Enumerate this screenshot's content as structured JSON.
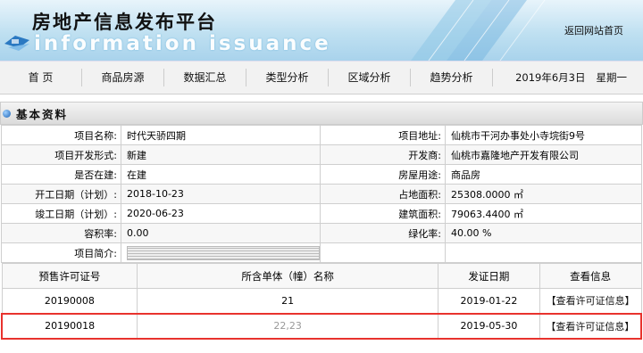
{
  "header": {
    "title": "房地产信息发布平台",
    "subtitle": "information issuance",
    "home_link": "返回网站首页"
  },
  "nav": {
    "items": [
      "首 页",
      "商品房源",
      "数据汇总",
      "类型分析",
      "区域分析",
      "趋势分析"
    ],
    "date": "2019年6月3日",
    "weekday": "星期一"
  },
  "section": {
    "title": "基本资料"
  },
  "info": {
    "rows": [
      {
        "l1": "项目名称:",
        "v1": "时代天骄四期",
        "l2": "项目地址:",
        "v2": "仙桃市干河办事处小寺垸街9号"
      },
      {
        "l1": "项目开发形式:",
        "v1": "新建",
        "l2": "开发商:",
        "v2": "仙桃市嘉隆地产开发有限公司"
      },
      {
        "l1": "是否在建:",
        "v1": "在建",
        "l2": "房屋用途:",
        "v2": "商品房"
      },
      {
        "l1": "开工日期（计划）:",
        "v1": "2018-10-23",
        "l2": "占地面积:",
        "v2": "25308.0000 ㎡"
      },
      {
        "l1": "竣工日期（计划）:",
        "v1": "2020-06-23",
        "l2": "建筑面积:",
        "v2": "79063.4400 ㎡"
      },
      {
        "l1": "容积率:",
        "v1": "0.00",
        "l2": "绿化率:",
        "v2": "40.00 %"
      }
    ],
    "intro_label": "项目简介:"
  },
  "permits": {
    "headers": [
      "预售许可证号",
      "所含单体（幢）名称",
      "发证日期",
      "查看信息"
    ],
    "rows": [
      {
        "no": "20190008",
        "units": "21",
        "date": "2019-01-22",
        "link": "【查看许可证信息】"
      },
      {
        "no": "20190018",
        "units": "22,23",
        "date": "2019-05-30",
        "link": "【查看许可证信息】"
      }
    ]
  },
  "colors": {
    "accent": "#e8322d",
    "header_blue": "#a9d3ec"
  }
}
